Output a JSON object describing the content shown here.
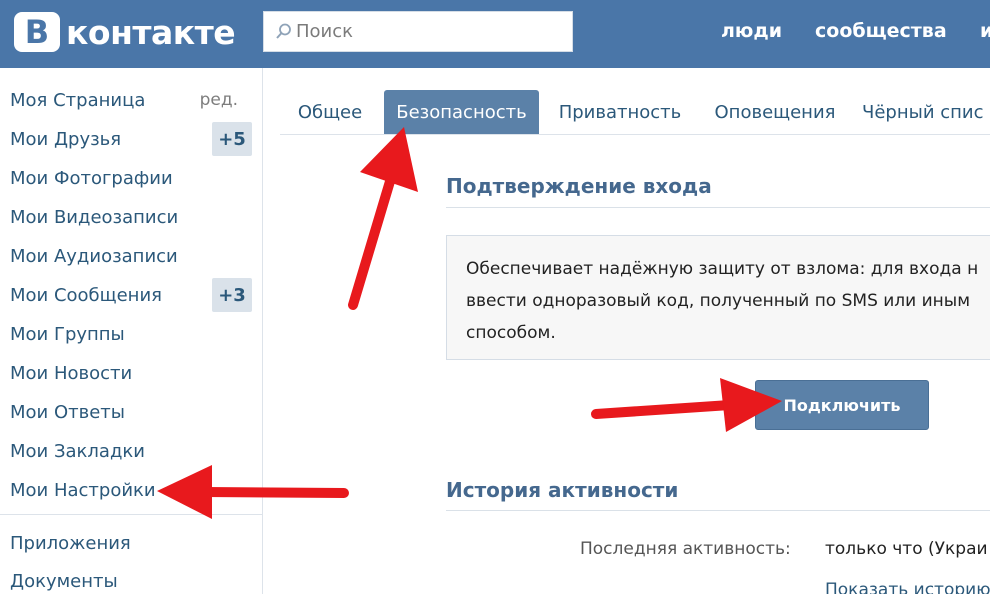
{
  "header": {
    "logo_letter": "В",
    "logo_text": "контакте",
    "search_placeholder": "Поиск",
    "links": [
      "люди",
      "сообщества",
      "и"
    ]
  },
  "sidebar": {
    "items": [
      {
        "label": "Моя Страница",
        "extra": "ред."
      },
      {
        "label": "Мои Друзья",
        "badge": "+5"
      },
      {
        "label": "Мои Фотографии"
      },
      {
        "label": "Мои Видеозаписи"
      },
      {
        "label": "Мои Аудиозаписи"
      },
      {
        "label": "Мои Сообщения",
        "badge": "+3"
      },
      {
        "label": "Мои Группы"
      },
      {
        "label": "Мои Новости"
      },
      {
        "label": "Мои Ответы"
      },
      {
        "label": "Мои Закладки"
      },
      {
        "label": "Мои Настройки"
      },
      {
        "label": "Приложения"
      },
      {
        "label": "Документы"
      }
    ]
  },
  "tabs": [
    "Общее",
    "Безопасность",
    "Приватность",
    "Оповещения",
    "Чёрный спис"
  ],
  "active_tab": "Безопасность",
  "login_confirm": {
    "title": "Подтверждение входа",
    "lines": [
      "Обеспечивает надёжную защиту от взлома: для входа н",
      "ввести одноразовый код, полученный по SMS или иным",
      "способом."
    ],
    "button": "Подключить"
  },
  "activity": {
    "title": "История активности",
    "last_label": "Последняя активность:",
    "last_value": "только что (Украи",
    "show_history": "Показать историю"
  },
  "colors": {
    "header_bg": "#4a76a8",
    "link": "#2b587a",
    "active_tab": "#5b81a8",
    "arrow": "#e8191d"
  }
}
